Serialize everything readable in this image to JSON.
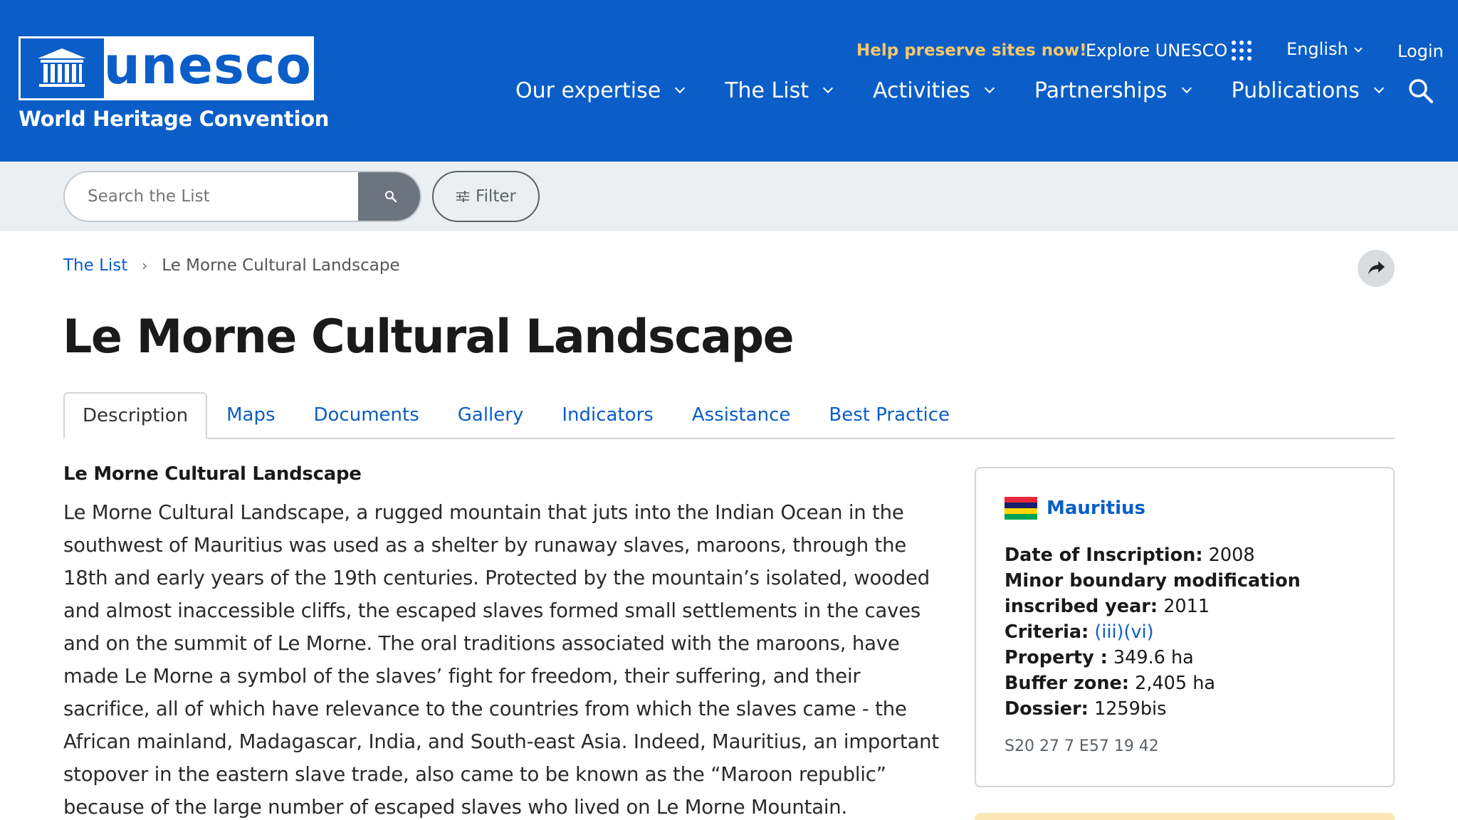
{
  "header": {
    "logo_word": "unesco",
    "logo_subtitle": "World Heritage Convention",
    "help_link": "Help preserve sites now!",
    "explore_link": "Explore UNESCO",
    "language": "English",
    "login": "Login",
    "nav": [
      {
        "label": "Our expertise"
      },
      {
        "label": "The List"
      },
      {
        "label": "Activities"
      },
      {
        "label": "Partnerships"
      },
      {
        "label": "Publications"
      }
    ]
  },
  "search": {
    "placeholder": "Search the List",
    "filter_label": "Filter"
  },
  "breadcrumb": {
    "root": "The List",
    "current": "Le Morne Cultural Landscape"
  },
  "page": {
    "title": "Le Morne Cultural Landscape"
  },
  "tabs": [
    {
      "label": "Description",
      "active": true
    },
    {
      "label": "Maps"
    },
    {
      "label": "Documents"
    },
    {
      "label": "Gallery"
    },
    {
      "label": "Indicators"
    },
    {
      "label": "Assistance"
    },
    {
      "label": "Best Practice"
    }
  ],
  "description": {
    "heading": "Le Morne Cultural Landscape",
    "body": "Le Morne Cultural Landscape, a rugged mountain that juts into the Indian Ocean in the southwest of Mauritius was used as a shelter by runaway slaves, maroons, through the 18th and early years of the 19th centuries. Protected by the mountain’s isolated, wooded and almost inaccessible cliffs, the escaped slaves formed small settlements in the caves and on the summit of Le Morne. The oral traditions associated with the maroons, have made Le Morne a symbol of the slaves’ fight for freedom, their suffering, and their sacrifice, all of which have relevance to the countries from which the slaves came - the African mainland, Madagascar, India, and South-east Asia. Indeed, Mauritius, an important stopover in the eastern slave trade, also came to be known as the “Maroon republic” because of the large number of escaped slaves who lived on Le Morne Mountain."
  },
  "info": {
    "country": "Mauritius",
    "flag_colors": [
      "#EA2839",
      "#1A206D",
      "#FFD500",
      "#00A551"
    ],
    "inscription_label": "Date of Inscription:",
    "inscription_value": "2008",
    "boundary_label": "Minor boundary modification inscribed year:",
    "boundary_value": "2011",
    "criteria_label": "Criteria:",
    "criteria_value": "(iii)(vi)",
    "property_label": "Property :",
    "property_value": "349.6 ha",
    "buffer_label": "Buffer zone:",
    "buffer_value": "2,405 ha",
    "dossier_label": "Dossier:",
    "dossier_value": "1259bis",
    "coordinates": "S20 27 7 E57 19 42"
  },
  "colors": {
    "brand_blue": "#0b5ec7",
    "help_yellow": "#f5c86b"
  }
}
